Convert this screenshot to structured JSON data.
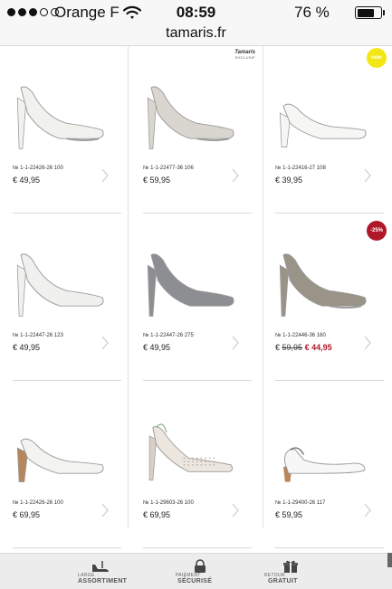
{
  "status_bar": {
    "carrier": "Orange F",
    "time": "08:59",
    "battery_percent": "76 %",
    "battery_level": 0.76,
    "signal_bars_filled": 3,
    "signal_bars_total": 5
  },
  "browser": {
    "url": "tamaris.fr"
  },
  "products": [
    {
      "sku": "№ 1-1-22426-26 100",
      "price": "€ 49,95",
      "old_price": null,
      "sale_price": null,
      "badge": null,
      "color": "#f1f1ee",
      "style": "pump-platform"
    },
    {
      "sku": "№ 1-1-22477-36 106",
      "price": "€ 59,95",
      "old_price": null,
      "sale_price": null,
      "badge": "exclusive",
      "color": "#d9d6cf",
      "style": "pump-lace"
    },
    {
      "sku": "№ 1-1-22416-27 108",
      "price": "€ 39,95",
      "old_price": null,
      "sale_price": null,
      "badge": "new",
      "color": "#f6f6f4",
      "style": "pump-low"
    },
    {
      "sku": "№ 1-1-22447-26 123",
      "price": "€ 49,95",
      "old_price": null,
      "sale_price": null,
      "badge": null,
      "color": "#f0f0ee",
      "style": "pointed"
    },
    {
      "sku": "№ 1-1-22447-26 275",
      "price": "€ 49,95",
      "old_price": null,
      "sale_price": null,
      "badge": null,
      "color": "#8d8e92",
      "style": "pointed-snake"
    },
    {
      "sku": "№ 1-1-22446-36 160",
      "price": null,
      "old_price": "59,95",
      "sale_price": "€ 44,95",
      "badge": "sale",
      "color": "#9a9388",
      "style": "pump-floral"
    },
    {
      "sku": "№ 1-1-22426-26 100",
      "price": "€ 69,95",
      "old_price": null,
      "sale_price": null,
      "badge": null,
      "color": "#f3f3f1",
      "style": "pump-wood"
    },
    {
      "sku": "№ 1-1-29603-26 100",
      "price": "€ 69,95",
      "old_price": null,
      "sale_price": null,
      "badge": null,
      "color": "#ece6df",
      "style": "slingback-perf"
    },
    {
      "sku": "№ 1-1-29400-26 117",
      "price": "€ 59,95",
      "old_price": null,
      "sale_price": null,
      "badge": null,
      "color": "#f7f7f7",
      "style": "slingback-flat"
    }
  ],
  "badges": {
    "new_label": "new",
    "sale_label": "-25%",
    "exclusive_brand": "Tamaris",
    "exclusive_label": "EXCLUSIF"
  },
  "footer": {
    "features": [
      {
        "small": "LARGE",
        "big": "ASSORTIMENT",
        "icon": "shoe-icon"
      },
      {
        "small": "PAIEMENT",
        "big": "SÉCURISÉ",
        "icon": "lock-icon"
      },
      {
        "small": "RETOUR",
        "big": "GRATUIT",
        "icon": "gift-icon"
      }
    ]
  },
  "colors": {
    "sale_red": "#b0182a",
    "new_yellow": "#f3e617"
  }
}
